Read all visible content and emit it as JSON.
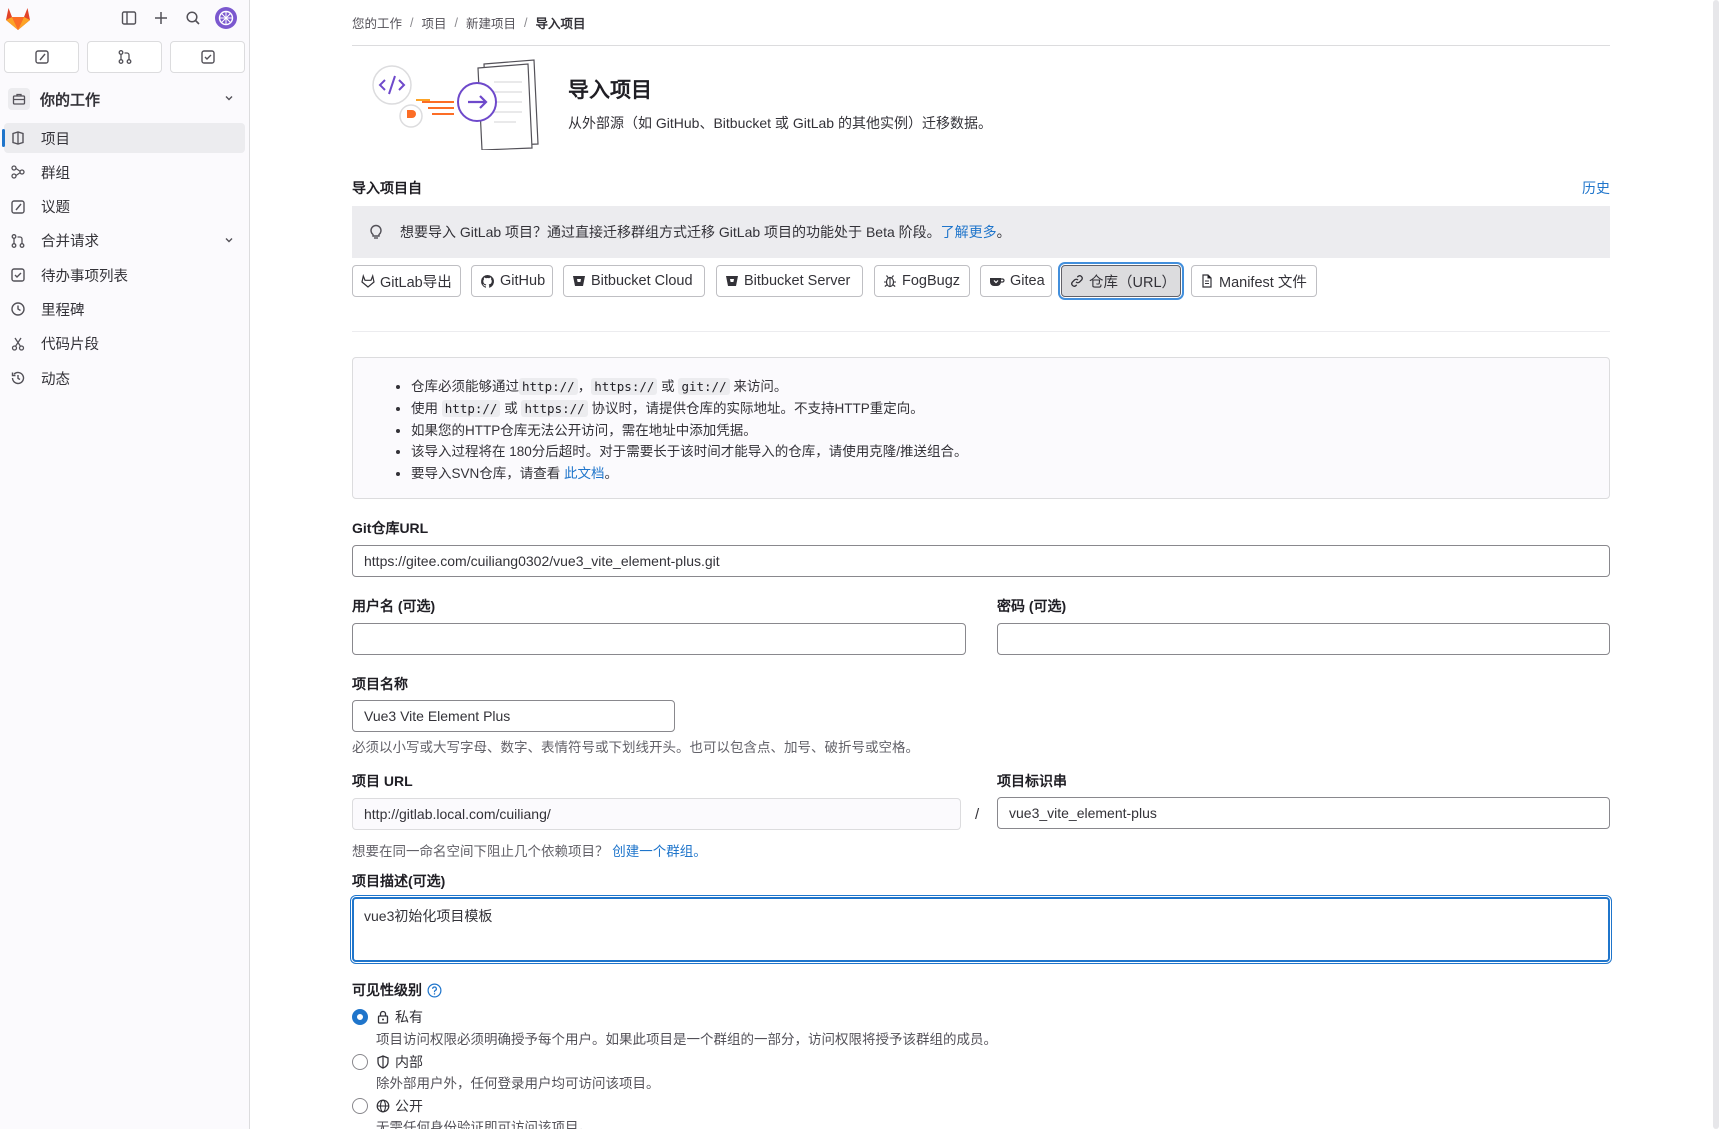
{
  "sidebar": {
    "context_label": "你的工作",
    "items": [
      {
        "label": "项目",
        "active": true
      },
      {
        "label": "群组"
      },
      {
        "label": "议题"
      },
      {
        "label": "合并请求",
        "has_chevron": true
      },
      {
        "label": "待办事项列表"
      },
      {
        "label": "里程碑"
      },
      {
        "label": "代码片段"
      },
      {
        "label": "动态"
      }
    ]
  },
  "breadcrumb": [
    "您的工作",
    "项目",
    "新建项目",
    "导入项目"
  ],
  "header": {
    "title": "导入项目",
    "description": "从外部源（如 GitHub、Bitbucket 或 GitLab 的其他实例）迁移数据。"
  },
  "import_source": {
    "label": "导入项目自",
    "history_link": "历史",
    "alert_text": "想要导入 GitLab 项目？通过直接迁移群组方式迁移 GitLab 项目的功能处于 Beta 阶段。",
    "alert_link": "了解更多",
    "alert_tail": "。",
    "buttons": [
      {
        "label": "GitLab导出",
        "icon": "tanuki-icon"
      },
      {
        "label": "GitHub",
        "icon": "github-icon"
      },
      {
        "label": "Bitbucket Cloud",
        "icon": "bitbucket-icon"
      },
      {
        "label": "Bitbucket Server",
        "icon": "bitbucket-icon"
      },
      {
        "label": "FogBugz",
        "icon": "bug-icon"
      },
      {
        "label": "Gitea",
        "icon": "gitea-icon"
      },
      {
        "label": "仓库（URL）",
        "icon": "link-icon",
        "selected": true
      },
      {
        "label": "Manifest 文件",
        "icon": "document-icon"
      }
    ]
  },
  "info": {
    "line1": {
      "a": "仓库必须能够通过",
      "c1": "http://",
      "b": "，",
      "c2": "https://",
      "c": "或",
      "c3": "git://",
      "d": "来访问。"
    },
    "line2": {
      "a": "使用",
      "c1": "http://",
      "b": "或",
      "c2": "https://",
      "c": "协议时，请提供仓库的实际地址。不支持HTTP重定向。"
    },
    "line3": "如果您的HTTP仓库无法公开访问，需在地址中添加凭据。",
    "line4": "该导入过程将在 180分后超时。对于需要长于该时间才能导入的仓库，请使用克隆/推送组合。",
    "line5": {
      "a": "要导入SVN仓库，请查看",
      "link": "此文档",
      "b": "。"
    }
  },
  "form": {
    "git_url_label": "Git仓库URL",
    "git_url_value": "https://gitee.com/cuiliang0302/vue3_vite_element-plus.git",
    "username_label": "用户名 (可选)",
    "username_value": "",
    "password_label": "密码 (可选)",
    "password_value": "",
    "project_name_label": "项目名称",
    "project_name_value": "Vue3 Vite Element Plus",
    "project_name_help": "必须以小写或大写字母、数字、表情符号或下划线开头。也可以包含点、加号、破折号或空格。",
    "project_url_label": "项目 URL",
    "project_url_value": "http://gitlab.local.com/cuiliang/",
    "slash": "/",
    "slug_label": "项目标识串",
    "slug_value": "vue3_vite_element-plus",
    "namespace_help": "想要在同一命名空间下阻止几个依赖项目？",
    "namespace_link": "创建一个群组。",
    "description_label": "项目描述(可选)",
    "description_value": "vue3初始化项目模板"
  },
  "visibility": {
    "title": "可见性级别",
    "options": [
      {
        "label": "私有",
        "icon": "lock-icon",
        "desc": "项目访问权限必须明确授予每个用户。如果此项目是一个群组的一部分，访问权限将授予该群组的成员。",
        "checked": true
      },
      {
        "label": "内部",
        "icon": "shield-icon",
        "desc": "除外部用户外，任何登录用户均可访问该项目。"
      },
      {
        "label": "公开",
        "icon": "earth-icon",
        "desc": "无需任何身份验证即可访问该项目。"
      }
    ]
  },
  "colors": {
    "accent": "#1f75cb",
    "brand": "#fc6d26",
    "avatar": "#7b58cf"
  }
}
